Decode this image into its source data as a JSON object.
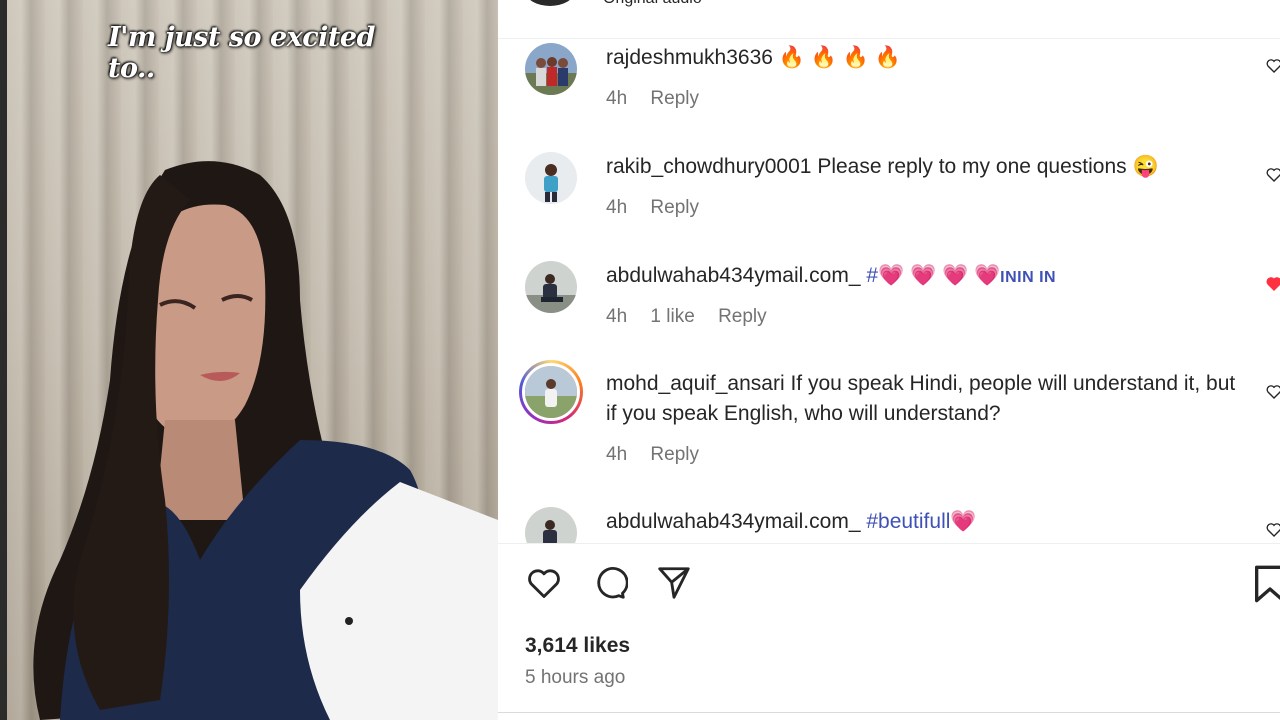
{
  "video": {
    "caption": "I'm just so excited to.."
  },
  "header": {
    "audio_label": "Original audio"
  },
  "comments": [
    {
      "username": "rajdeshmukh3636",
      "text": "🔥 🔥 🔥 🔥",
      "time": "4h",
      "likes": "",
      "reply": "Reply",
      "liked": false
    },
    {
      "username": "rakib_chowdhury0001",
      "text": "Please reply to my one questions 😜",
      "time": "4h",
      "likes": "",
      "reply": "Reply",
      "liked": false
    },
    {
      "username": "abdulwahab434ymail.com_",
      "tag_prefix": "#",
      "text": "💗 💗 💗 💗",
      "tag_suffix": "ININ IN",
      "time": "4h",
      "likes": "1 like",
      "reply": "Reply",
      "liked": true
    },
    {
      "username": "mohd_aquif_ansari",
      "text": "If you speak Hindi, people will understand it, but if you speak English, who will understand?",
      "time": "4h",
      "likes": "",
      "reply": "Reply",
      "liked": false
    },
    {
      "username": "abdulwahab434ymail.com_",
      "tag": "#beutifull",
      "text": "💗",
      "liked": false
    }
  ],
  "post": {
    "likes": "3,614 likes",
    "time_ago": "5 hours ago"
  },
  "colors": {
    "link_blue": "#3f51b5",
    "muted": "#737373",
    "like_red": "#ff3040"
  }
}
